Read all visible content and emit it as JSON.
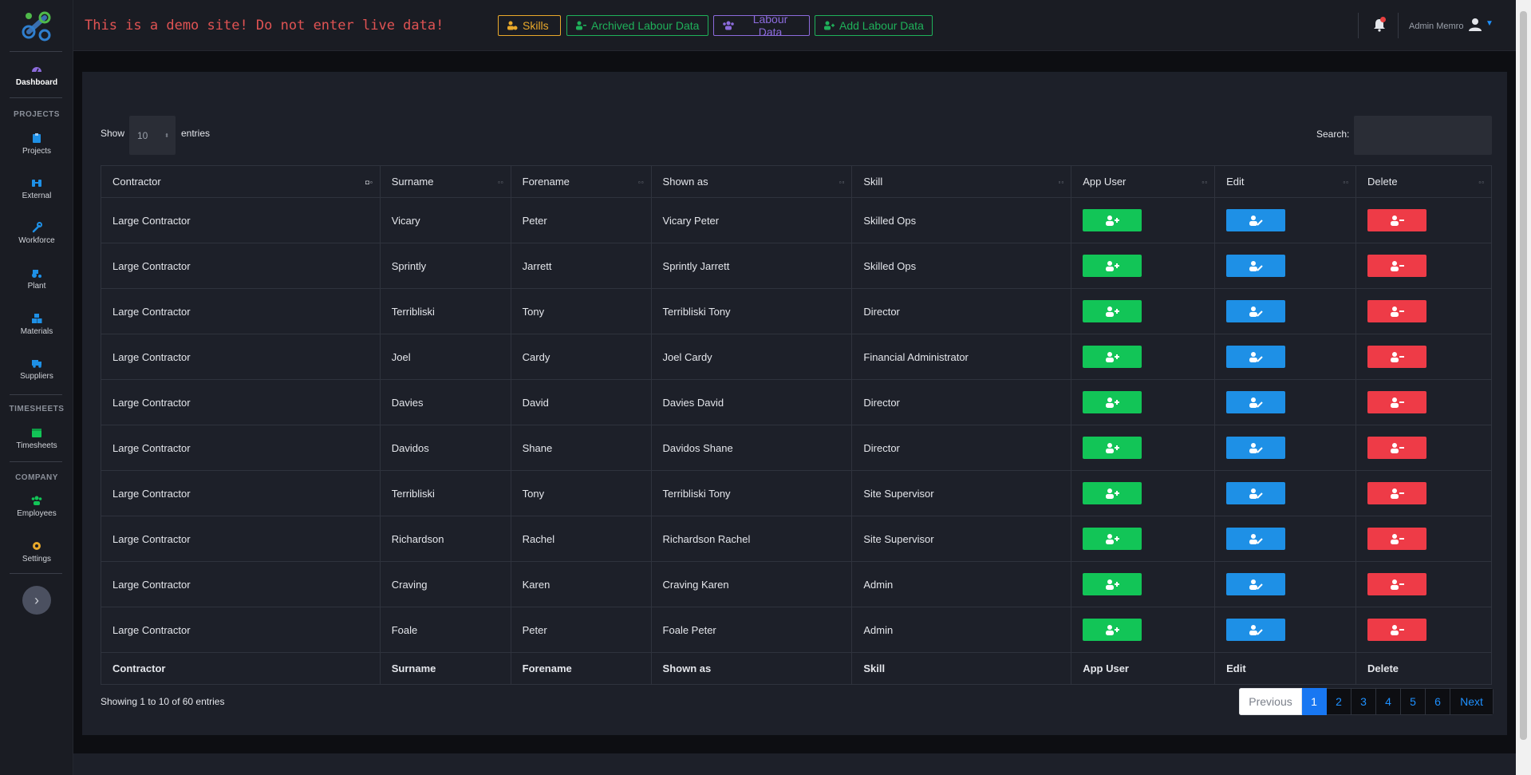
{
  "sidebar": {
    "dashboard": "Dashboard",
    "sections": {
      "projects": "PROJECTS",
      "timesheets": "TIMESHEETS",
      "company": "COMPANY"
    },
    "items": {
      "projects": "Projects",
      "external": "External",
      "workforce": "Workforce",
      "plant": "Plant",
      "materials": "Materials",
      "suppliers": "Suppliers",
      "timesheets": "Timesheets",
      "employees": "Employees",
      "settings": "Settings"
    },
    "toggle_icon": "chevron-right-icon"
  },
  "topbar": {
    "demo_warning": "This is a demo site! Do not enter live data!",
    "buttons": {
      "skills": "Skills",
      "archived": "Archived Labour Data",
      "labour": "Labour Data",
      "add": "Add Labour Data"
    },
    "user_name": "Admin Memro"
  },
  "table_controls": {
    "show": "Show",
    "page_size": "10",
    "entries": "entries",
    "search_label": "Search:",
    "search_value": ""
  },
  "columns": [
    "Contractor",
    "Surname",
    "Forename",
    "Shown as",
    "Skill",
    "App User",
    "Edit",
    "Delete"
  ],
  "rows": [
    {
      "contractor": "Large Contractor",
      "surname": "Vicary",
      "forename": "Peter",
      "shown_as": "Vicary Peter",
      "skill": "Skilled Ops"
    },
    {
      "contractor": "Large Contractor",
      "surname": "Sprintly",
      "forename": "Jarrett",
      "shown_as": "Sprintly Jarrett",
      "skill": "Skilled Ops"
    },
    {
      "contractor": "Large Contractor",
      "surname": "Terribliski",
      "forename": "Tony",
      "shown_as": "Terribliski Tony",
      "skill": "Director"
    },
    {
      "contractor": "Large Contractor",
      "surname": "Joel",
      "forename": "Cardy",
      "shown_as": "Joel Cardy",
      "skill": "Financial Administrator"
    },
    {
      "contractor": "Large Contractor",
      "surname": "Davies",
      "forename": "David",
      "shown_as": "Davies David",
      "skill": "Director"
    },
    {
      "contractor": "Large Contractor",
      "surname": "Davidos",
      "forename": "Shane",
      "shown_as": "Davidos Shane",
      "skill": "Director"
    },
    {
      "contractor": "Large Contractor",
      "surname": "Terribliski",
      "forename": "Tony",
      "shown_as": "Terribliski Tony",
      "skill": "Site Supervisor"
    },
    {
      "contractor": "Large Contractor",
      "surname": "Richardson",
      "forename": "Rachel",
      "shown_as": "Richardson Rachel",
      "skill": "Site Supervisor"
    },
    {
      "contractor": "Large Contractor",
      "surname": "Craving",
      "forename": "Karen",
      "shown_as": "Craving Karen",
      "skill": "Admin"
    },
    {
      "contractor": "Large Contractor",
      "surname": "Foale",
      "forename": "Peter",
      "shown_as": "Foale Peter",
      "skill": "Admin"
    }
  ],
  "footer": {
    "info": "Showing 1 to 10 of 60 entries",
    "previous": "Previous",
    "pages": [
      "1",
      "2",
      "3",
      "4",
      "5",
      "6"
    ],
    "current_page": "1",
    "next": "Next"
  },
  "colors": {
    "app_user": "#12c557",
    "edit": "#1e90e6",
    "delete": "#ee3b47",
    "skills": "#e9a92b",
    "labour": "#8c6bdc",
    "archived": "#1fb15a",
    "demo_warning": "#e05353"
  }
}
